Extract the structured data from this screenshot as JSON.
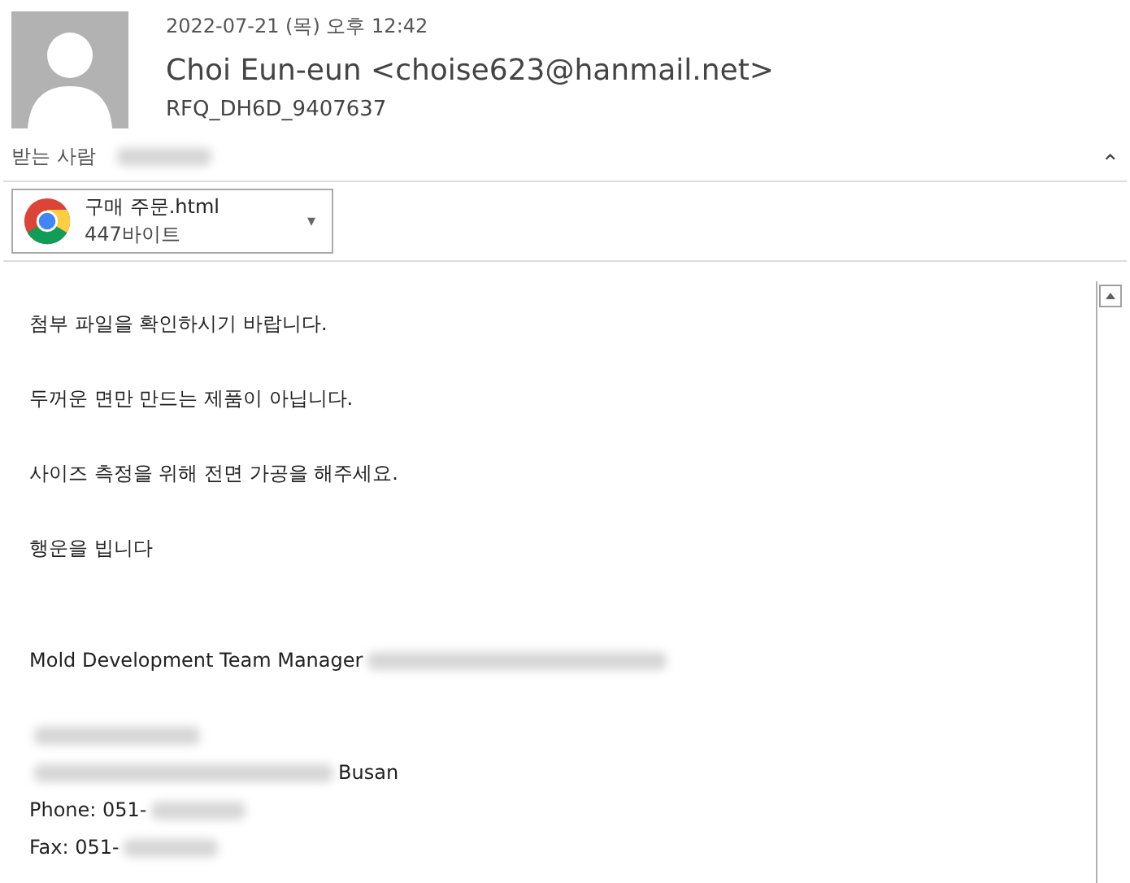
{
  "header": {
    "date": "2022-07-21 (목) 오후 12:42",
    "sender": "Choi Eun-eun <choise623@hanmail.net>",
    "subject": "RFQ_DH6D_9407637",
    "to_label": "받는 사람",
    "to_parts": [
      {
        "kind": "redacted_short"
      }
    ]
  },
  "attachment": {
    "name": "구매 주문.html",
    "size": "447바이트",
    "dropdown": "▾"
  },
  "collapse": "⌃",
  "body": [
    {
      "kind": "line",
      "parts": [
        {
          "kind": "text",
          "text": "첨부 파일을 확인하시기 바랍니다."
        }
      ]
    },
    {
      "kind": "blank"
    },
    {
      "kind": "line",
      "parts": [
        {
          "kind": "text",
          "text": "두꺼운 면만 만드는 제품이 아닙니다."
        }
      ]
    },
    {
      "kind": "blank"
    },
    {
      "kind": "line",
      "parts": [
        {
          "kind": "text",
          "text": "사이즈 측정을 위해 전면 가공을 해주세요."
        }
      ]
    },
    {
      "kind": "blank"
    },
    {
      "kind": "line",
      "parts": [
        {
          "kind": "text",
          "text": "행운을 빕니다"
        }
      ]
    },
    {
      "kind": "blank"
    },
    {
      "kind": "blank"
    },
    {
      "kind": "line",
      "parts": [
        {
          "kind": "text",
          "text": "Mold Development Team Manager"
        },
        {
          "kind": "redacted_long"
        }
      ]
    },
    {
      "kind": "blank"
    },
    {
      "kind": "line",
      "parts": [
        {
          "kind": "redacted_medium"
        }
      ]
    },
    {
      "kind": "line",
      "parts": [
        {
          "kind": "redacted_long"
        },
        {
          "kind": "text",
          "text": "Busan"
        }
      ]
    },
    {
      "kind": "line",
      "parts": [
        {
          "kind": "text",
          "text": "Phone: 051-"
        },
        {
          "kind": "redacted_short"
        }
      ]
    },
    {
      "kind": "line",
      "parts": [
        {
          "kind": "text",
          "text": "Fax: 051-"
        },
        {
          "kind": "redacted_short"
        }
      ]
    }
  ]
}
